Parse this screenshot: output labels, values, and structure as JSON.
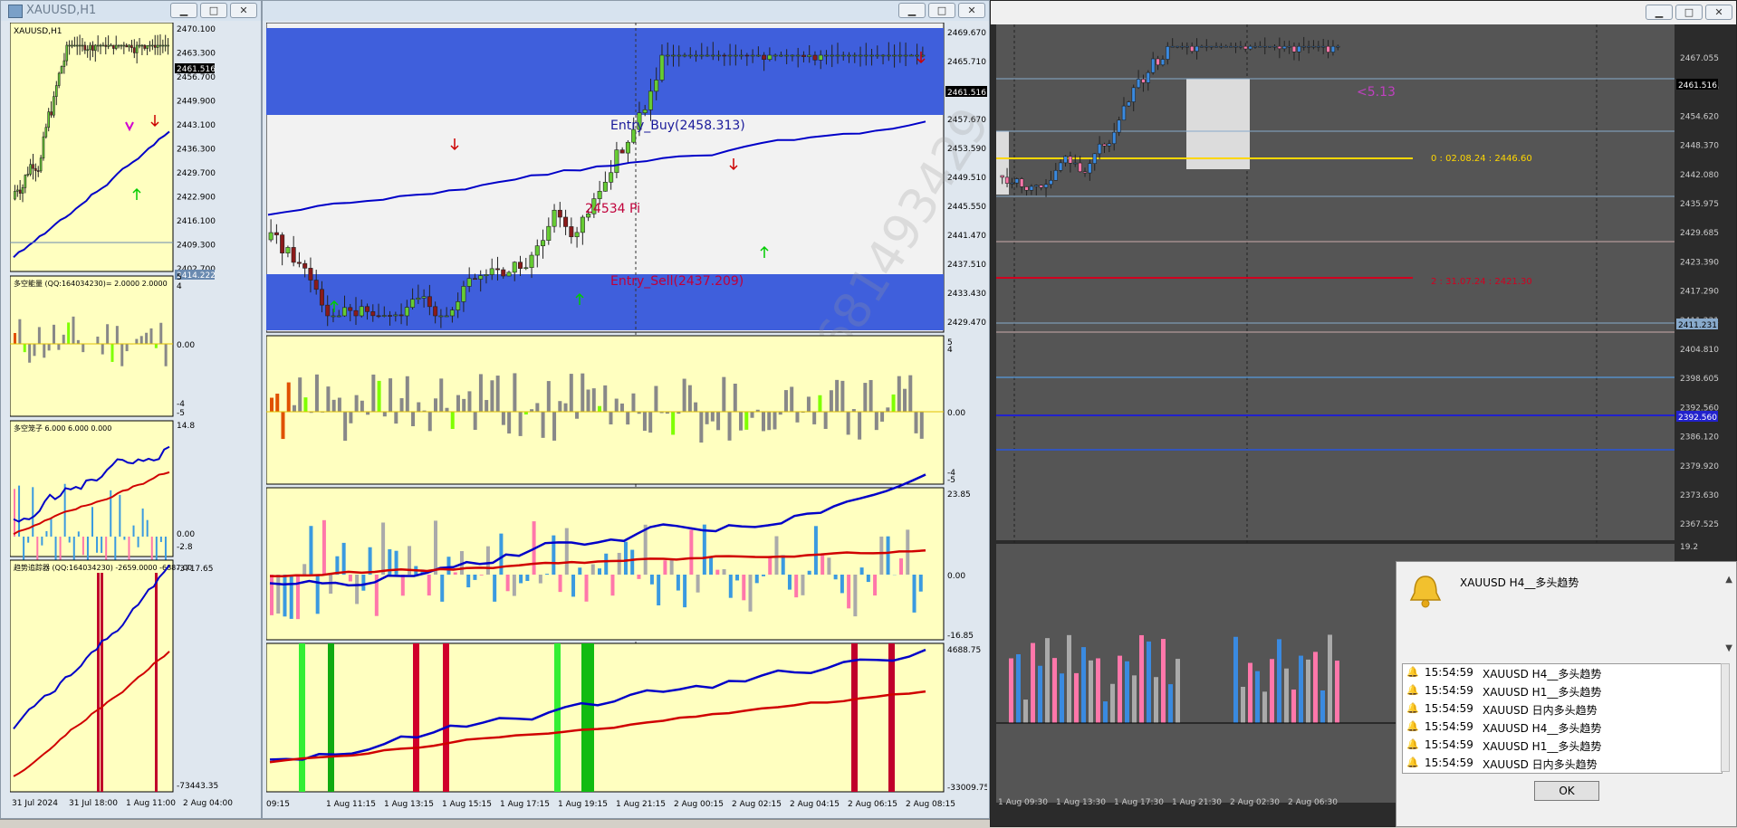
{
  "colors": {
    "chart_bg": "#ffffc0",
    "dark_bg": "#555555",
    "bull_candle": "#66cc33",
    "bear_candle": "#8b1a1a",
    "ma_blue": "#0000c8",
    "ma_red": "#d00000",
    "zone_blue": "#3f5fdc",
    "zone_white": "#f2f2f2"
  },
  "window_left": {
    "title": "XAUUSD,H1",
    "chart_label": "XAUUSD,H1",
    "price_ticks": [
      "2470.100",
      "2463.300",
      "2456.700",
      "2449.900",
      "2443.100",
      "2436.300",
      "2429.700",
      "2422.900",
      "2416.100",
      "2409.300",
      "2402.700"
    ],
    "current_price": "2461.516",
    "line_price": "2414.222",
    "ind1_label": "多空能量 (QQ:164034230)= 2.0000 2.0000",
    "ind1_ticks": [
      "5",
      "4",
      "0.00",
      "-4",
      "-5"
    ],
    "ind2_label": "多空笼子 6.000 6.000 0.000",
    "ind2_ticks": [
      "14.8",
      "0.00",
      "-2.8"
    ],
    "ind3_label": "趋势追踪器 (QQ:164034230) -2659.0000 -6887.00",
    "ind3_ticks": [
      "-3717.65",
      "-73443.35"
    ],
    "time_labels": [
      "31 Jul 2024",
      "31 Jul 18:00",
      "1 Aug 11:00",
      "2 Aug 04:00"
    ]
  },
  "window_middle": {
    "entry_buy": "Entry_Buy(2458.313)",
    "entry_sell": "Entry_Sell(2437.209)",
    "pips_label": "24534 Pi",
    "price_ticks": [
      "2469.670",
      "2465.710",
      "2461.516",
      "2457.670",
      "2453.590",
      "2449.510",
      "2445.550",
      "2441.470",
      "2437.510",
      "2433.430",
      "2429.470"
    ],
    "current_price": "2461.516",
    "ind1_ticks": [
      "5",
      "4",
      "0.00",
      "-4",
      "-5"
    ],
    "ind2_ticks": [
      "23.85",
      "0.00",
      "-16.85"
    ],
    "ind3_ticks": [
      "4688.75",
      "-33009.75"
    ],
    "time_labels": [
      "09:15",
      "1 Aug 11:15",
      "1 Aug 13:15",
      "1 Aug 15:15",
      "1 Aug 17:15",
      "1 Aug 19:15",
      "1 Aug 21:15",
      "2 Aug 00:15",
      "2 Aug 02:15",
      "2 Aug 04:15",
      "2 Aug 06:15",
      "2 Aug 08:15"
    ],
    "watermark": "18681493429"
  },
  "window_right": {
    "price_ticks": [
      "2467.055",
      "2461.516",
      "2454.620",
      "2448.370",
      "2442.080",
      "2435.975",
      "2429.685",
      "2423.390",
      "2417.290",
      "2411.231",
      "2404.810",
      "2398.605",
      "2392.560",
      "2386.120",
      "2379.920",
      "2373.630",
      "2367.525"
    ],
    "current_price": "2461.516",
    "level_price_1": "2411.231",
    "level_price_2": "2392.560",
    "minus_label": "<5.13",
    "level1_label": "0 : 02.08.24 : 2446.60",
    "level2_label": "2 : 31.07.24 : 2421.30",
    "subwin_value": "19.2",
    "time_labels": [
      "1 Aug 09:30",
      "1 Aug 13:30",
      "1 Aug 17:30",
      "1 Aug 21:30",
      "2 Aug 02:30",
      "2 Aug 06:30"
    ]
  },
  "alert": {
    "headline": "XAUUSD  H4__多头趋势",
    "rows": [
      {
        "time": "15:54:59",
        "text": "XAUUSD  H4__多头趋势"
      },
      {
        "time": "15:54:59",
        "text": "XAUUSD  H1__多头趋势"
      },
      {
        "time": "15:54:59",
        "text": "XAUUSD  日内多头趋势"
      },
      {
        "time": "15:54:59",
        "text": "XAUUSD  H4__多头趋势"
      },
      {
        "time": "15:54:59",
        "text": "XAUUSD  H1__多头趋势"
      },
      {
        "time": "15:54:59",
        "text": "XAUUSD  日内多头趋势"
      }
    ],
    "ok_label": "OK"
  }
}
